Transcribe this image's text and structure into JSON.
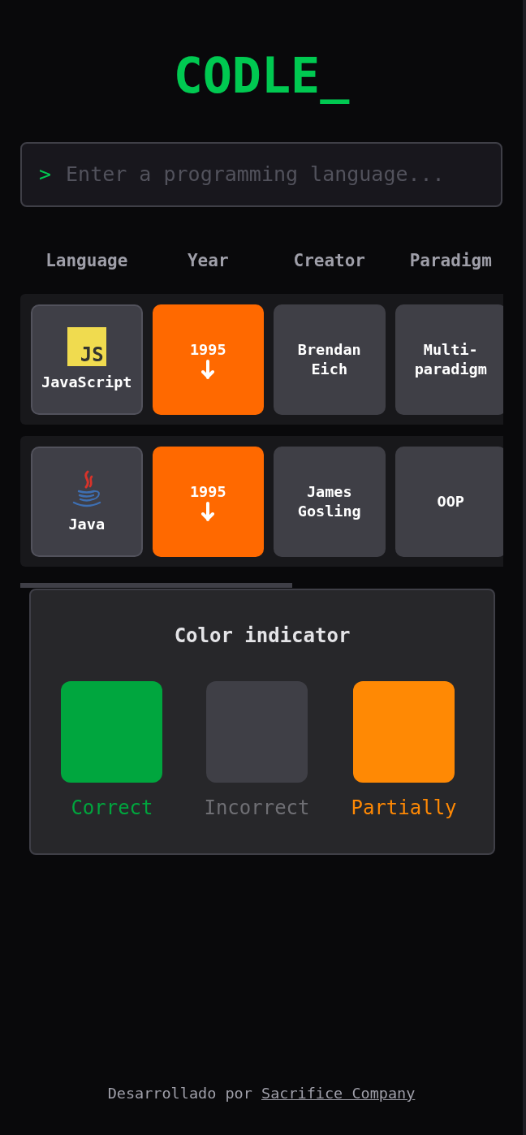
{
  "title": "CODLE_",
  "search": {
    "prompt": ">",
    "placeholder": "Enter a programming language..."
  },
  "columns": [
    "Language",
    "Year",
    "Creator",
    "Paradigm"
  ],
  "guesses": [
    {
      "language": "JavaScript",
      "logo": {
        "kind": "badge",
        "text": "JS"
      },
      "cells": [
        {
          "text": "1995",
          "color": "#ff6900",
          "arrow_down": true
        },
        {
          "text": "Brendan Eich",
          "color": "#3f3f46",
          "arrow_down": false
        },
        {
          "text": "Multi-paradigm",
          "color": "#3f3f46",
          "arrow_down": false
        }
      ]
    },
    {
      "language": "Java",
      "logo": {
        "kind": "cup"
      },
      "cells": [
        {
          "text": "1995",
          "color": "#ff6900",
          "arrow_down": true
        },
        {
          "text": "James Gosling",
          "color": "#3f3f46",
          "arrow_down": false
        },
        {
          "text": "OOP",
          "color": "#3f3f46",
          "arrow_down": false
        }
      ]
    }
  ],
  "legend": {
    "title": "Color indicator",
    "items": [
      {
        "label": "Correct",
        "color": "#00a63e"
      },
      {
        "label": "Incorrect",
        "color": "#3f3f46"
      },
      {
        "label": "Partially",
        "color": "#ff8904"
      }
    ]
  },
  "footer": {
    "text": "Desarrollado por",
    "link": "Sacrifice Company"
  }
}
